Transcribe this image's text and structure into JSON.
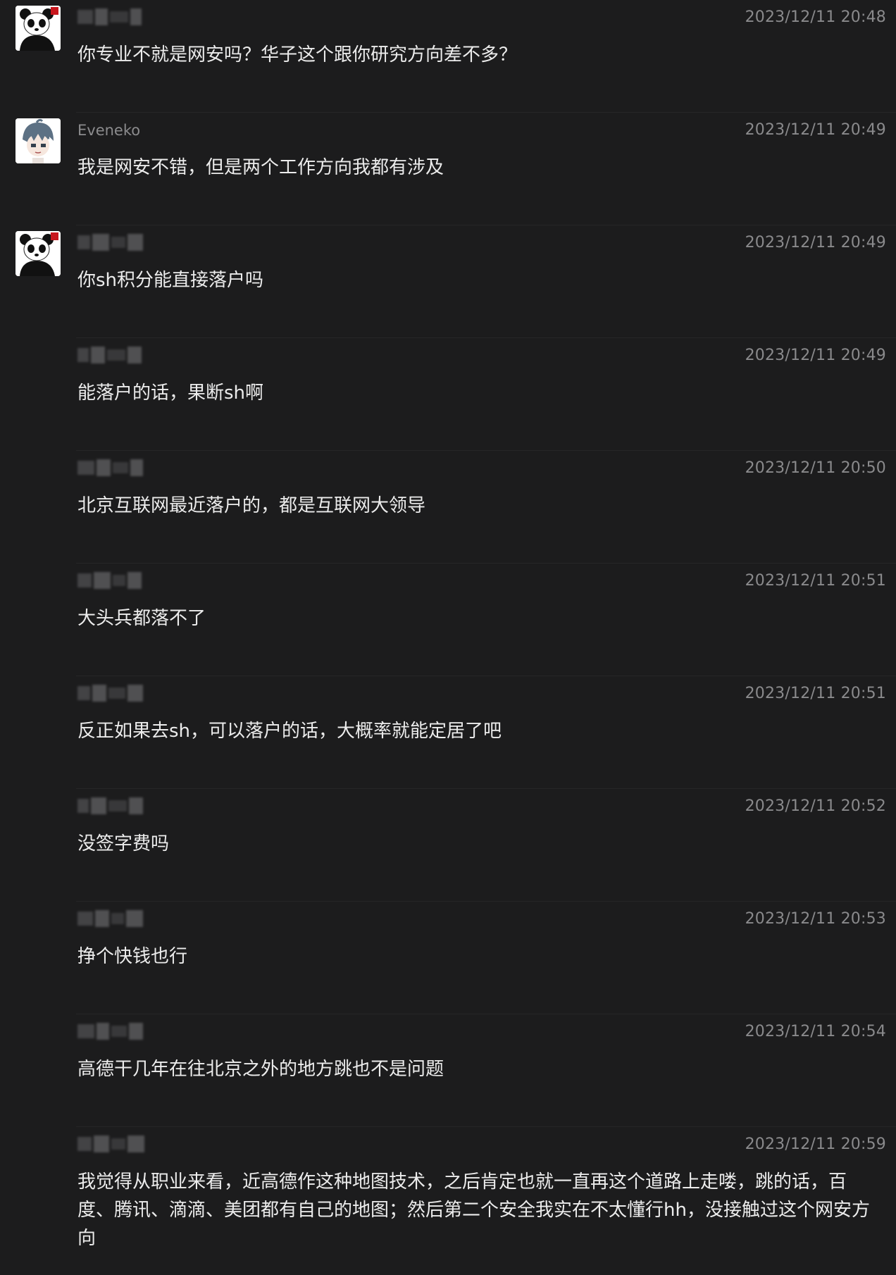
{
  "messages": [
    {
      "sender": "",
      "sender_hidden": true,
      "avatar": "panda-avatar",
      "time": "2023/12/11 20:48",
      "text": "你专业不就是网安吗？华子这个跟你研究方向差不多？"
    },
    {
      "sender": "Eveneko",
      "sender_hidden": false,
      "avatar": "anime-boy-avatar",
      "time": "2023/12/11 20:49",
      "text": "我是网安不错，但是两个工作方向我都有涉及"
    },
    {
      "sender": "",
      "sender_hidden": true,
      "avatar": "panda-avatar",
      "time": "2023/12/11 20:49",
      "text": "你sh积分能直接落户吗"
    },
    {
      "sender": "",
      "sender_hidden": true,
      "avatar": "",
      "time": "2023/12/11 20:49",
      "text": "能落户的话，果断sh啊"
    },
    {
      "sender": "",
      "sender_hidden": true,
      "avatar": "",
      "time": "2023/12/11 20:50",
      "text": "北京互联网最近落户的，都是互联网大领导"
    },
    {
      "sender": "",
      "sender_hidden": true,
      "avatar": "",
      "time": "2023/12/11 20:51",
      "text": "大头兵都落不了"
    },
    {
      "sender": "",
      "sender_hidden": true,
      "avatar": "",
      "time": "2023/12/11 20:51",
      "text": "反正如果去sh，可以落户的话，大概率就能定居了吧"
    },
    {
      "sender": "",
      "sender_hidden": true,
      "avatar": "",
      "time": "2023/12/11 20:52",
      "text": "没签字费吗"
    },
    {
      "sender": "",
      "sender_hidden": true,
      "avatar": "",
      "time": "2023/12/11 20:53",
      "text": "挣个快钱也行"
    },
    {
      "sender": "",
      "sender_hidden": true,
      "avatar": "",
      "time": "2023/12/11 20:54",
      "text": "高德干几年在往北京之外的地方跳也不是问题"
    },
    {
      "sender": "",
      "sender_hidden": true,
      "avatar": "",
      "time": "2023/12/11 20:59",
      "text": "我觉得从职业来看，近高德作这种地图技术，之后肯定也就一直再这个道路上走喽，跳的话，百度、腾讯、滴滴、美团都有自己的地图；然后第二个安全我实在不太懂行hh，没接触过这个网安方向"
    }
  ]
}
